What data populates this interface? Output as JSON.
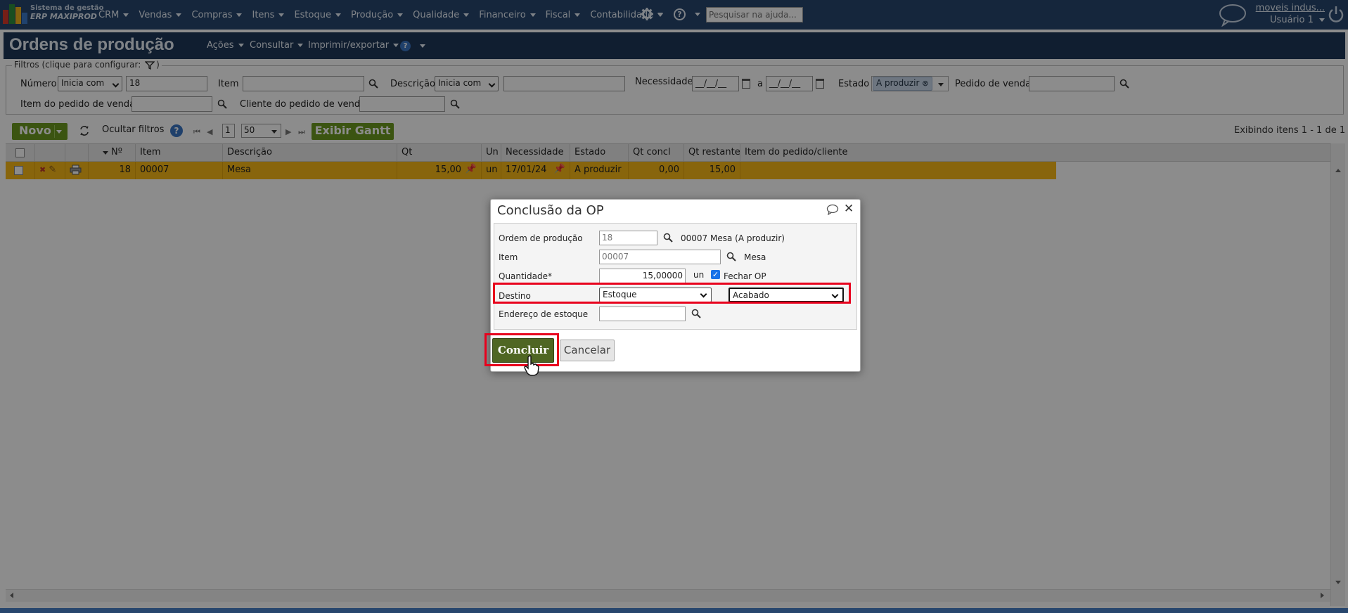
{
  "app": {
    "logo_line1": "Sistema de gestão",
    "logo_line2": "ERP MAXIPROD",
    "menu": [
      "CRM",
      "Vendas",
      "Compras",
      "Itens",
      "Estoque",
      "Produção",
      "Qualidade",
      "Financeiro",
      "Fiscal",
      "Contabilidade"
    ],
    "search_placeholder": "Pesquisar na ajuda...",
    "user_link": "moveis indus...",
    "user_name": "Usuário 1"
  },
  "page": {
    "title": "Ordens de produção",
    "menus": [
      "Ações",
      "Consultar",
      "Imprimir/exportar"
    ]
  },
  "filters": {
    "legend": "Filtros (clique para configurar:",
    "legend_close": ")",
    "numero_label": "Número",
    "numero_mode": "Inicia com",
    "numero_value": "18",
    "item_label": "Item",
    "descricao_label": "Descrição",
    "descricao_mode": "Inicia com",
    "necessidade_label": "Necessidade",
    "date_from": "__/__/__",
    "date_sep": "a",
    "date_to": "__/__/__",
    "estado_label": "Estado",
    "estado_tag": "A produzir",
    "pedido_label": "Pedido de venda",
    "item_pedido_label": "Item do pedido de venda",
    "cliente_label": "Cliente do pedido de venda"
  },
  "toolbar": {
    "novo": "Novo",
    "ocultar": "Ocultar filtros",
    "page": "1",
    "page_size": "50",
    "gantt": "Exibir Gantt",
    "showing": "Exibindo itens 1 - 1 de 1"
  },
  "grid": {
    "headers": [
      "Nº",
      "Item",
      "Descrição",
      "Qt",
      "Un",
      "Necessidade",
      "Estado",
      "Qt concl",
      "Qt restante",
      "Item do pedido/cliente"
    ],
    "row": {
      "numero": "18",
      "item": "00007",
      "descricao": "Mesa",
      "qt": "15,00",
      "un": "un",
      "necessidade": "17/01/24",
      "estado": "A produzir",
      "qt_concl": "0,00",
      "qt_restante": "15,00"
    }
  },
  "dialog": {
    "title": "Conclusão da OP",
    "ordem_label": "Ordem de produção",
    "ordem_value": "18",
    "ordem_desc": "00007 Mesa (A produzir)",
    "item_label": "Item",
    "item_value": "00007",
    "item_desc": "Mesa",
    "qtd_label": "Quantidade*",
    "qtd_value": "15,00000",
    "qtd_unit": "un",
    "fechar_label": "Fechar OP",
    "destino_label": "Destino",
    "destino_value": "Estoque",
    "destino2_value": "Acabado",
    "endereco_label": "Endereço de estoque",
    "concluir": "Concluir",
    "cancelar": "Cancelar"
  },
  "colors": {
    "nav": "#27466d",
    "titlebar": "#1e3758",
    "accent_green": "#6c9a1f",
    "concluir": "#4f6623",
    "row_highlight": "#f7b917",
    "annotation_red": "#e8001c"
  }
}
